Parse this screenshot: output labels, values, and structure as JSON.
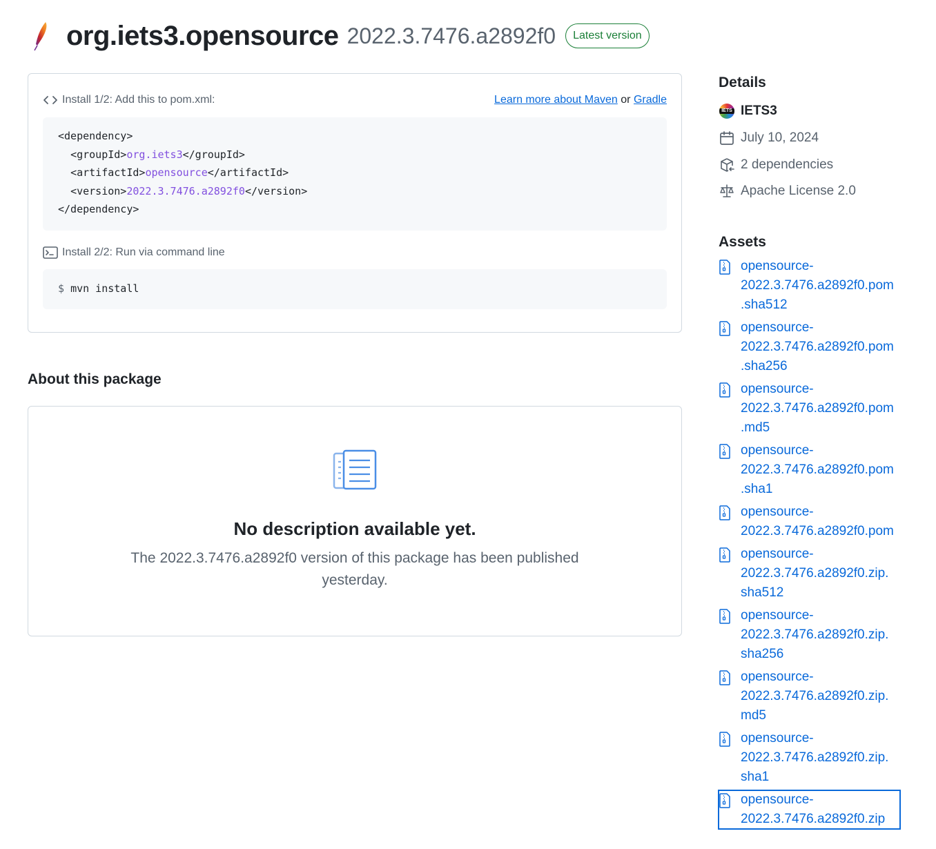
{
  "header": {
    "name": "org.iets3.opensource",
    "version": "2022.3.7476.a2892f0",
    "badge": "Latest version"
  },
  "install": {
    "step1_label": "Install 1/2: Add this to pom.xml:",
    "learn_more_link": "Learn more about Maven",
    "or_text": "or",
    "gradle_link": "Gradle",
    "pom": {
      "open_dependency": "<dependency>",
      "group_open": "<groupId>",
      "group_value": "org.iets3",
      "group_close": "</groupId>",
      "artifact_open": "<artifactId>",
      "artifact_value": "opensource",
      "artifact_close": "</artifactId>",
      "version_open": "<version>",
      "version_value": "2022.3.7476.a2892f0",
      "version_close": "</version>",
      "close_dependency": "</dependency>"
    },
    "step2_label": "Install 2/2: Run via command line",
    "command_prompt": "$",
    "command": "mvn install"
  },
  "about": {
    "title": "About this package",
    "empty_title": "No description available yet.",
    "empty_desc": "The 2022.3.7476.a2892f0 version of this package has been published yesterday."
  },
  "details": {
    "title": "Details",
    "owner": "IETS3",
    "owner_avatar_text": "IETS",
    "date": "July 10, 2024",
    "dependencies": "2 dependencies",
    "license": "Apache License 2.0"
  },
  "assets": {
    "title": "Assets",
    "items": [
      "opensource-\n2022.3.7476.a2892f0.pom\n.sha512",
      "opensource-\n2022.3.7476.a2892f0.pom\n.sha256",
      "opensource-\n2022.3.7476.a2892f0.pom\n.md5",
      "opensource-\n2022.3.7476.a2892f0.pom\n.sha1",
      "opensource-\n2022.3.7476.a2892f0.pom",
      "opensource-\n2022.3.7476.a2892f0.zip.\nsha512",
      "opensource-\n2022.3.7476.a2892f0.zip.\nsha256",
      "opensource-\n2022.3.7476.a2892f0.zip.\nmd5",
      "opensource-\n2022.3.7476.a2892f0.zip.\nsha1",
      "opensource-\n2022.3.7476.a2892f0.zip"
    ]
  },
  "colors": {
    "link": "#0969da",
    "badge_green": "#1a7f37",
    "code_highlight": "#8250df",
    "muted": "#59636e"
  }
}
